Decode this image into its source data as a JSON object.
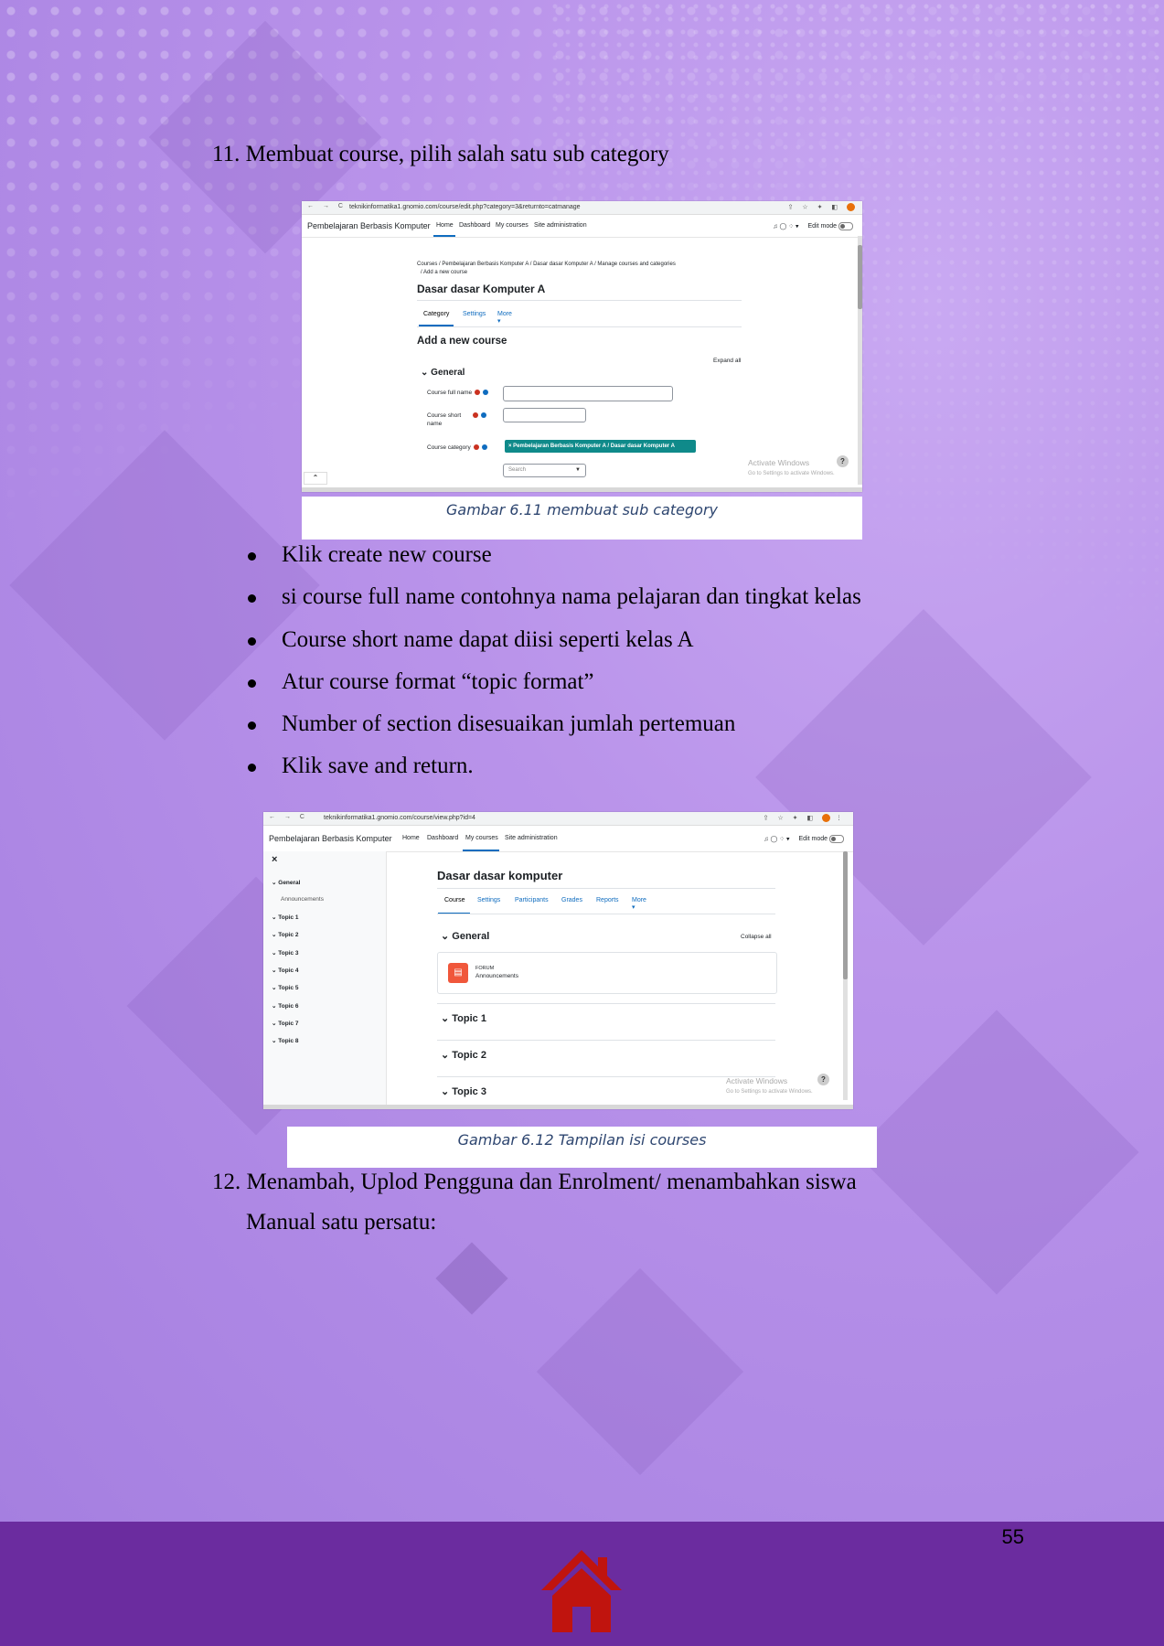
{
  "step11": {
    "number": "11.",
    "text": "Membuat course, pilih salah satu sub category"
  },
  "screenshot1": {
    "url": "teknikinformatika1.gnomio.com/course/edit.php?category=3&returnto=catmanage",
    "site_name": "Pembelajaran Berbasis Komputer",
    "nav": [
      "Home",
      "Dashboard",
      "My courses",
      "Site administration"
    ],
    "edit_mode": "Edit mode",
    "breadcrumb": "Courses / Pembelajaran Berbasis Komputer A / Dasar dasar Komputer A / Manage courses and categories",
    "breadcrumb2": "/ Add a new course",
    "title": "Dasar dasar Komputer A",
    "tabs": [
      "Category",
      "Settings",
      "More ▾"
    ],
    "form_title": "Add a new course",
    "expand_all": "Expand all",
    "section": "General",
    "field_fullname": "Course full name",
    "field_shortname_1": "Course short",
    "field_shortname_2": "name",
    "field_category": "Course category",
    "category_value": "× Pembelajaran Berbasis Komputer A / Dasar dasar Komputer A",
    "search_placeholder": "Search",
    "watermark_1": "Activate Windows",
    "watermark_2": "Go to Settings to activate Windows.",
    "help": "?"
  },
  "caption1": "Gambar 6.11 membuat sub category",
  "bullets": [
    "Klik create new course",
    "si course full name contohnya nama pelajaran dan tingkat kelas",
    "Course short name dapat diisi seperti kelas A",
    "Atur course format “topic format”",
    "Number of section disesuaikan jumlah pertemuan",
    "Klik save and return."
  ],
  "screenshot2": {
    "url": "teknikinformatika1.gnomio.com/course/view.php?id=4",
    "site_name": "Pembelajaran Berbasis Komputer",
    "nav": [
      "Home",
      "Dashboard",
      "My courses",
      "Site administration"
    ],
    "edit_mode": "Edit mode",
    "close": "×",
    "sidebar": [
      "General",
      "Announcements",
      "Topic 1",
      "Topic 2",
      "Topic 3",
      "Topic 4",
      "Topic 5",
      "Topic 6",
      "Topic 7",
      "Topic 8"
    ],
    "title": "Dasar dasar komputer",
    "tabs": [
      "Course",
      "Settings",
      "Participants",
      "Grades",
      "Reports",
      "More ▾"
    ],
    "section": "General",
    "collapse_all": "Collapse all",
    "forum_label": "FORUM",
    "forum_name": "Announcements",
    "topics": [
      "Topic 1",
      "Topic 2",
      "Topic 3"
    ],
    "watermark_1": "Activate Windows",
    "watermark_2": "Go to Settings to activate Windows.",
    "help": "?"
  },
  "caption2": "Gambar 6.12 Tampilan isi courses",
  "step12": {
    "number": "12.",
    "line1": "Menambah, Uplod Pengguna dan Enrolment/ menambahkan siswa",
    "line2": "Manual satu persatu:"
  },
  "page_number": "55",
  "colors": {
    "footer": "#6b2c9f",
    "home_icon": "#c0140e",
    "caption": "#2e4670",
    "accent": "#0f6cbf",
    "category_badge": "#0f8a8a",
    "forum_icon": "#f0573b"
  }
}
